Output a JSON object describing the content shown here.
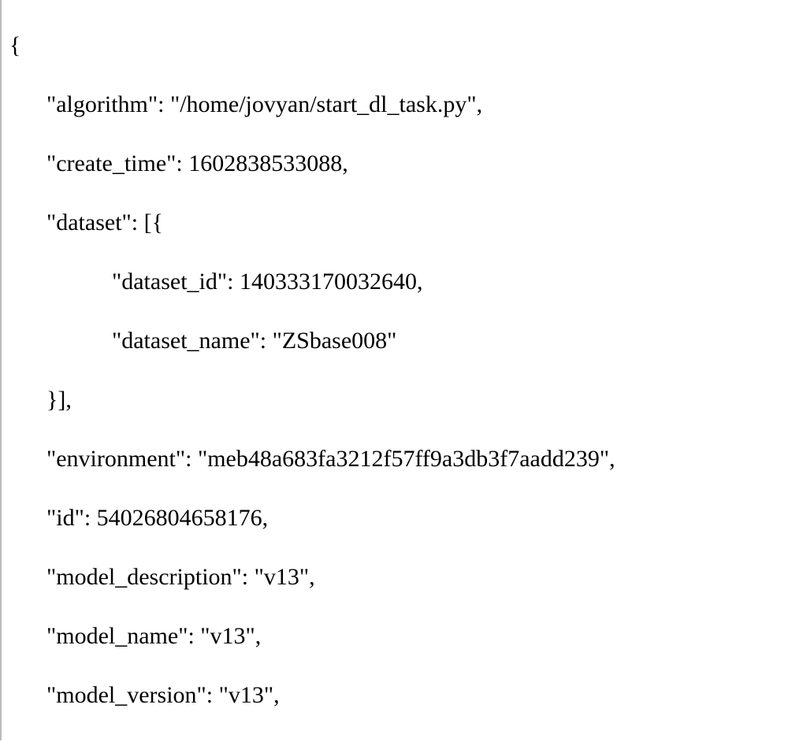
{
  "lines": {
    "l1": "{",
    "l2": "\"algorithm\": \"/home/jovyan/start_dl_task.py\",",
    "l3": "\"create_time\": 1602838533088,",
    "l4": "\"dataset\": [{",
    "l5": "\"dataset_id\": 140333170032640,",
    "l6": "\"dataset_name\": \"ZSbase008\"",
    "l7": "}],",
    "l8": "\"environment\": \"meb48a683fa3212f57ff9a3db3f7aadd239\",",
    "l9": "\"id\": 54026804658176,",
    "l10": "\"model_description\": \"v13\",",
    "l11": "\"model_name\": \"v13\",",
    "l12": "\"model_version\": \"v13\","
  }
}
